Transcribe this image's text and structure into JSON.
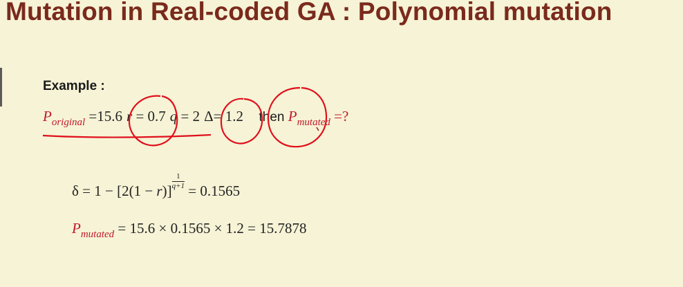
{
  "slide": {
    "title": "Mutation in Real-coded GA : Polynomial mutation",
    "example_label": "Example :"
  },
  "given": {
    "p_symbol": "P",
    "p_sub": "original",
    "eq1": "=",
    "p_value": "15.6",
    "r_symbol": "r",
    "r_eq": " = 0.7",
    "q_symbol": "q",
    "q_eq": " = 2",
    "delta_text": "Δ= 1.2",
    "then_word": "then",
    "pm_symbol": "P",
    "pm_sub": "mutated",
    "question": " =?"
  },
  "delta_eq": {
    "lhs": "δ = 1 − [2(1 − ",
    "r_symbol": "r",
    "close": ")]",
    "exp_num": "1",
    "exp_den": "q+1",
    "rhs": " = 0.1565"
  },
  "result_eq": {
    "p_symbol": "P",
    "p_sub": "mutated",
    "rhs": " = 15.6 × 0.1565 × 1.2 = 15.7878"
  },
  "colors": {
    "title": "#7a2a1c",
    "highlight": "#c0192b",
    "ink": "#e0101c",
    "background": "#f6f3d6"
  }
}
